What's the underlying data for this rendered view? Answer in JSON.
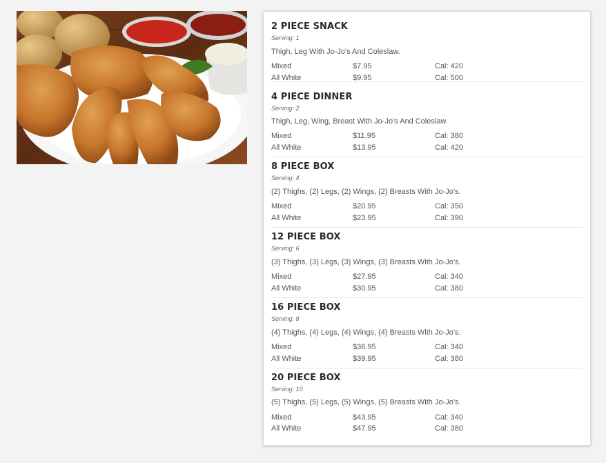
{
  "image": {
    "alt_icon": "fried-chicken-photo"
  },
  "menu": {
    "items": [
      {
        "title": "2 PIECE SNACK",
        "serving": "Serving: 1",
        "description": "Thigh, Leg With Jo-Jo's And Coleslaw.",
        "options": [
          {
            "name": "Mixed",
            "price": "$7.95",
            "cal": "Cal: 420"
          },
          {
            "name": "All White",
            "price": "$9.95",
            "cal": "Cal: 500"
          }
        ]
      },
      {
        "title": "4 PIECE DINNER",
        "serving": "Serving: 2",
        "description": "Thigh, Leg, Wing, Breast With Jo-Jo's And Coleslaw.",
        "options": [
          {
            "name": "Mixed",
            "price": "$11.95",
            "cal": "Cal: 380"
          },
          {
            "name": "All White",
            "price": "$13.95",
            "cal": "Cal: 420"
          }
        ]
      },
      {
        "title": "8 PIECE BOX",
        "serving": "Serving: 4",
        "description": "(2) Thighs, (2) Legs, (2) Wings, (2) Breasts With Jo-Jo's.",
        "options": [
          {
            "name": "Mixed",
            "price": "$20.95",
            "cal": "Cal: 350"
          },
          {
            "name": "All White",
            "price": "$23.95",
            "cal": "Cal: 390"
          }
        ]
      },
      {
        "title": "12 PIECE BOX",
        "serving": "Serving: 6",
        "description": "(3) Thighs, (3) Legs, (3) Wings, (3) Breasts With Jo-Jo's.",
        "options": [
          {
            "name": "Mixed",
            "price": "$27.95",
            "cal": "Cal: 340"
          },
          {
            "name": "All White",
            "price": "$30.95",
            "cal": "Cal: 380"
          }
        ]
      },
      {
        "title": "16 PIECE BOX",
        "serving": "Serving: 8",
        "description": "(4) Thighs, (4) Legs, (4) Wings, (4) Breasts With Jo-Jo's.",
        "options": [
          {
            "name": "Mixed",
            "price": "$36.95",
            "cal": "Cal: 340"
          },
          {
            "name": "All White",
            "price": "$39.95",
            "cal": "Cal: 380"
          }
        ]
      },
      {
        "title": "20 PIECE BOX",
        "serving": "Serving: 10",
        "description": "(5) Thighs, (5) Legs, (5) Wings, (5) Breasts With Jo-Jo's.",
        "options": [
          {
            "name": "Mixed",
            "price": "$43.95",
            "cal": "Cal: 340"
          },
          {
            "name": "All White",
            "price": "$47.95",
            "cal": "Cal: 380"
          }
        ]
      }
    ]
  },
  "colors": {
    "page_bg": "#f3f3f3",
    "card_bg": "#ffffff",
    "title": "#2a2a2a",
    "text": "#555555"
  }
}
